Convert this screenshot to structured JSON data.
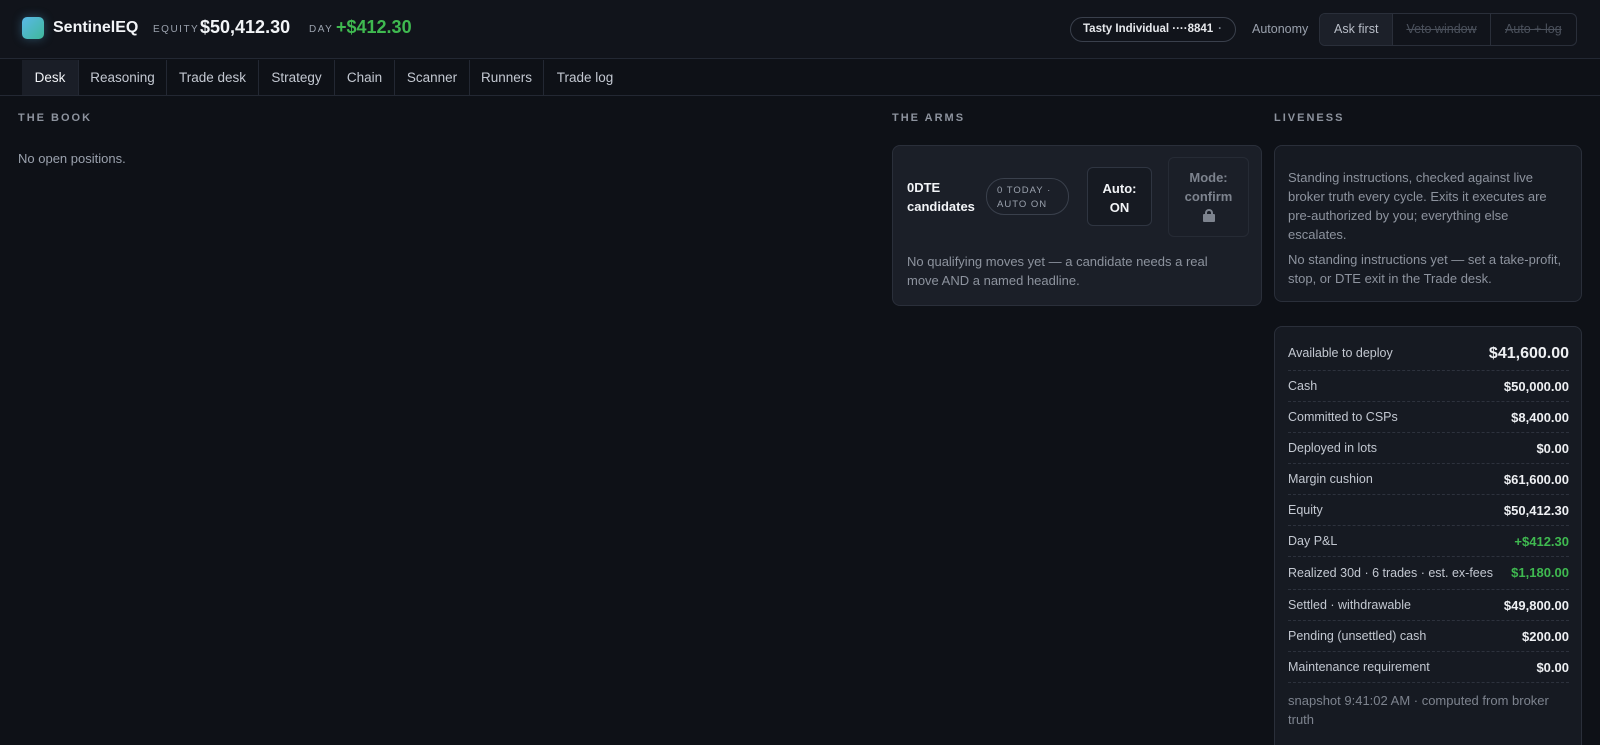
{
  "header": {
    "app_name": "SentinelEQ",
    "equity_label": "EQUITY",
    "equity_value": "$50,412.30",
    "day_label": "DAY",
    "day_value": "+$412.30",
    "account_name": "Tasty Individual ····8841",
    "account_caret": "·",
    "autonomy_label": "Autonomy",
    "autonomy_options": [
      "Ask first",
      "Veto window",
      "Auto + log"
    ],
    "autonomy_selected": "Ask first"
  },
  "tabs": [
    "Desk",
    "Reasoning",
    "Trade desk",
    "Strategy",
    "Chain",
    "Scanner",
    "Runners",
    "Trade log"
  ],
  "active_tab": "Desk",
  "book": {
    "title": "THE BOOK",
    "empty_text": "No open positions."
  },
  "arms": {
    "title": "THE ARMS",
    "card": {
      "name": "0DTE candidates",
      "badge_line1": "0 TODAY ·",
      "badge_line2": "AUTO ON",
      "auto_line1": "Auto:",
      "auto_line2": "ON",
      "mode_line1": "Mode:",
      "mode_line2": "confirm",
      "mode_icon": "lock-icon",
      "note": "No qualifying moves yet — a candidate needs a real move AND a named headline."
    }
  },
  "liveness": {
    "title": "LIVENESS",
    "p1": "Standing instructions, checked against live broker truth every cycle. Exits it executes are pre-authorized by you; everything else escalates.",
    "p2": "No standing instructions yet — set a take-profit, stop, or DTE exit in the Trade desk."
  },
  "capital": {
    "rows": [
      {
        "label": "Available to deploy",
        "value": "$41,600.00"
      },
      {
        "label": "Cash",
        "value": "$50,000.00"
      },
      {
        "label": "Committed to CSPs",
        "value": "$8,400.00"
      },
      {
        "label": "Deployed in lots",
        "value": "$0.00"
      },
      {
        "label": "Margin cushion",
        "value": "$61,600.00"
      },
      {
        "label": "Equity",
        "value": "$50,412.30"
      },
      {
        "label": "Day P&L",
        "value": "+$412.30"
      },
      {
        "label": "Realized 30d · 6 trades · est. ex-fees",
        "value": "$1,180.00"
      },
      {
        "label": "Settled · withdrawable",
        "value": "$49,800.00"
      },
      {
        "label": "Pending (unsettled) cash",
        "value": "$200.00"
      },
      {
        "label": "Maintenance requirement",
        "value": "$0.00"
      }
    ],
    "snapshot": "snapshot 9:41:02 AM · computed from broker truth"
  },
  "colors": {
    "background": "#0e1117",
    "positive": "#3fb950",
    "accent_logo_start": "#5ab8e8",
    "accent_logo_end": "#3fb89a"
  }
}
